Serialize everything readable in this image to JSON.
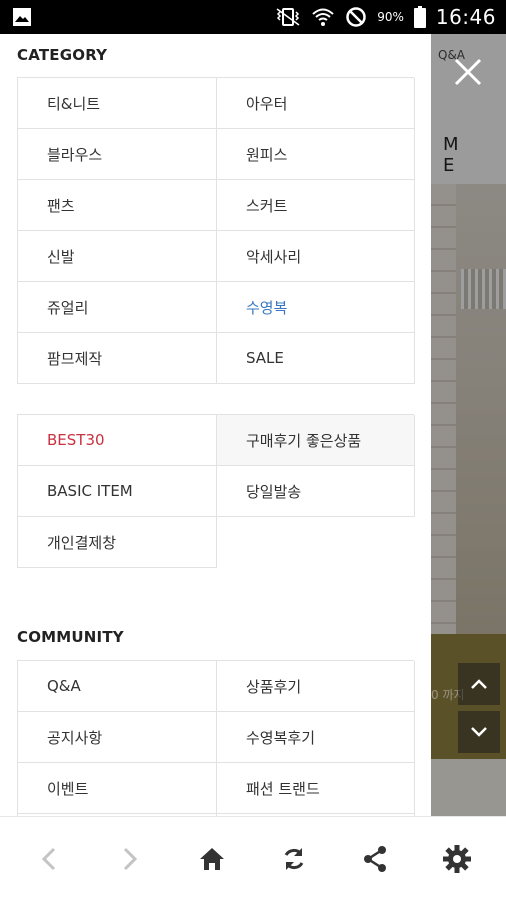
{
  "status_bar": {
    "battery": "90%",
    "time": "16:46",
    "icons": [
      "image-notification-icon",
      "vibrate-icon",
      "wifi-icon",
      "do-not-disturb-icon",
      "battery-icon"
    ]
  },
  "background_page": {
    "qna_label": "Q&A",
    "header_letters": "M E",
    "banner_fragment": "0 까지"
  },
  "drawer": {
    "category_title": "CATEGORY",
    "category_items": [
      "티&니트",
      "아우터",
      "블라우스",
      "원피스",
      "팬츠",
      "스커트",
      "신발",
      "악세사리",
      "쥬얼리",
      "수영복",
      "팜므제작",
      "SALE"
    ],
    "special_items": [
      "BEST30",
      "구매후기 좋은상품",
      "BASIC ITEM",
      "당일발송",
      "개인결제창"
    ],
    "community_title": "COMMUNITY",
    "community_items": [
      "Q&A",
      "상품후기",
      "공지사항",
      "수영복후기",
      "이벤트",
      "패션 트랜드"
    ]
  },
  "colors": {
    "highlight_blue": "#3a78c2",
    "highlight_red": "#c8313f",
    "icon_gray": "#333333",
    "disabled_gray": "#c4c4c4"
  },
  "bottom_nav": [
    "back-icon",
    "forward-icon",
    "home-icon",
    "refresh-icon",
    "share-icon",
    "settings-icon"
  ]
}
